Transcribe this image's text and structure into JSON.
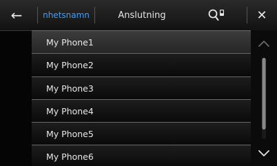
{
  "header": {
    "back_icon": "arrow-left-icon",
    "tabs": [
      {
        "label": "nhetsnamn",
        "active": true
      },
      {
        "label": "Anslutning",
        "active": false
      }
    ],
    "search_icon": "search-phone-icon",
    "close_icon": "close-icon"
  },
  "devices": [
    {
      "label": "My Phone1"
    },
    {
      "label": "My Phone2"
    },
    {
      "label": "My Phone3"
    },
    {
      "label": "My Phone4"
    },
    {
      "label": "My Phone5"
    },
    {
      "label": "My Phone6"
    }
  ],
  "scrollbar": {
    "up_icon": "chevron-up-icon",
    "down_icon": "chevron-down-icon"
  },
  "colors": {
    "accent": "#3aa0ff",
    "text": "#e8e8e8",
    "background": "#050505"
  }
}
